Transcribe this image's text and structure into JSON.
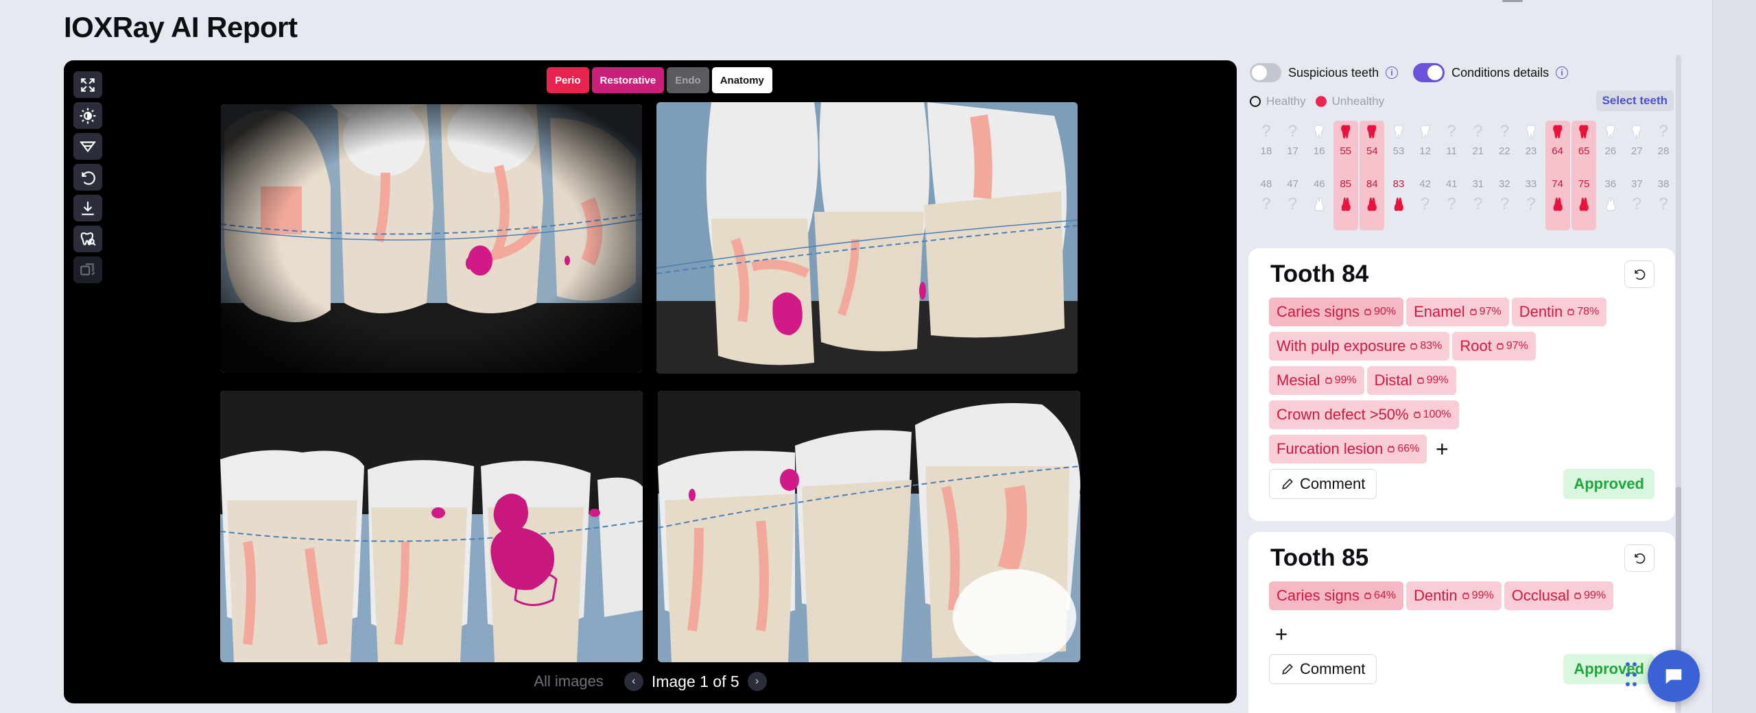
{
  "page": {
    "title": "IOXRay AI Report"
  },
  "viewer": {
    "tools": [
      "expand-icon",
      "brightness-icon",
      "filter-icon",
      "undo-icon",
      "download-icon",
      "tooth-search-icon",
      "copy-export-icon"
    ],
    "filters": [
      {
        "label": "Perio",
        "state": "active",
        "color": "#e8234f"
      },
      {
        "label": "Restorative",
        "state": "active",
        "color": "#cc1f7b"
      },
      {
        "label": "Endo",
        "state": "disabled"
      },
      {
        "label": "Anatomy",
        "state": "selected"
      }
    ],
    "pager": {
      "all_images": "All images",
      "label": "Image 1 of 5",
      "prev_icon": "chevron-left-icon",
      "next_icon": "chevron-right-icon"
    }
  },
  "panel": {
    "toggle_suspicious": {
      "label": "Suspicious teeth",
      "on": false
    },
    "toggle_conditions": {
      "label": "Conditions details",
      "on": true
    },
    "legend": {
      "healthy": "Healthy",
      "unhealthy": "Unhealthy"
    },
    "select_teeth": "Select teeth",
    "tooth_chart": {
      "upper": [
        "18",
        "17",
        "16",
        "55",
        "54",
        "53",
        "12",
        "11",
        "21",
        "22",
        "23",
        "64",
        "65",
        "26",
        "27",
        "28"
      ],
      "lower": [
        "48",
        "47",
        "46",
        "85",
        "84",
        "83",
        "42",
        "41",
        "31",
        "32",
        "33",
        "74",
        "75",
        "36",
        "37",
        "38"
      ],
      "highlighted": [
        "55",
        "54",
        "64",
        "65",
        "85",
        "84",
        "83",
        "74",
        "75"
      ]
    },
    "cards": [
      {
        "title": "Tooth 84",
        "tags": [
          {
            "label": "Caries signs",
            "pct": "90%"
          },
          {
            "label": "Enamel",
            "pct": "97%"
          },
          {
            "label": "Dentin",
            "pct": "78%"
          },
          {
            "label": "With pulp exposure",
            "pct": "83%"
          },
          {
            "label": "Root",
            "pct": "97%"
          },
          {
            "label": "Mesial",
            "pct": "99%"
          },
          {
            "label": "Distal",
            "pct": "99%"
          },
          {
            "label": "Crown defect >50%",
            "pct": "100%"
          },
          {
            "label": "Furcation lesion",
            "pct": "66%"
          }
        ],
        "comment": "Comment",
        "status": "Approved"
      },
      {
        "title": "Tooth 85",
        "tags": [
          {
            "label": "Caries signs",
            "pct": "64%"
          },
          {
            "label": "Dentin",
            "pct": "99%"
          },
          {
            "label": "Occlusal",
            "pct": "99%"
          }
        ],
        "comment": "Comment",
        "status": "Approved"
      }
    ]
  },
  "colors": {
    "accent": "#6b52d9",
    "unhealthy": "#f0244f",
    "tag_bg": "#f8cdd5",
    "tag_text": "#d4173f",
    "approved": "#1ca83a"
  }
}
